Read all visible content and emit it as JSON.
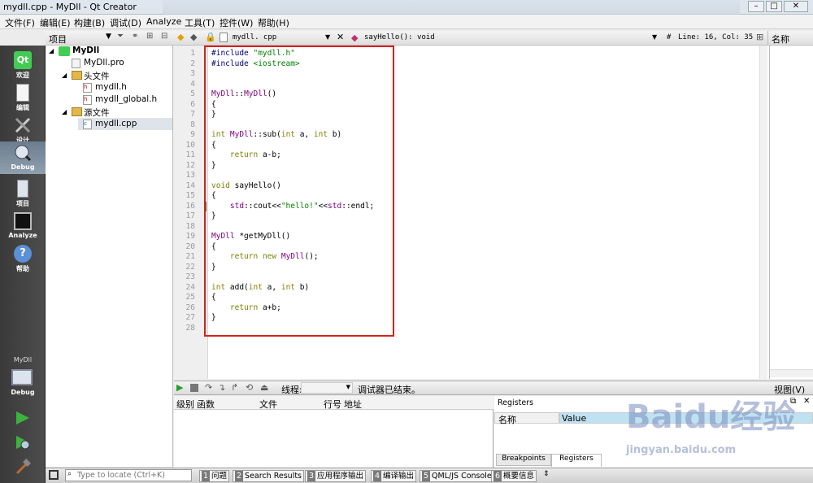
{
  "window": {
    "title": "mydll.cpp - MyDll - Qt Creator"
  },
  "menubar": {
    "items": [
      "文件(F)",
      "编辑(E)",
      "构建(B)",
      "调试(D)",
      "Analyze",
      "工具(T)",
      "控件(W)",
      "帮助(H)"
    ]
  },
  "modes": [
    {
      "label": "欢迎",
      "icon": "qt-logo-icon"
    },
    {
      "label": "编辑",
      "icon": "document-icon"
    },
    {
      "label": "设计",
      "icon": "design-tools-icon"
    },
    {
      "label": "Debug",
      "icon": "debug-bug-icon",
      "active": true
    },
    {
      "label": "项目",
      "icon": "project-icon"
    },
    {
      "label": "Analyze",
      "icon": "analyze-monitor-icon"
    },
    {
      "label": "帮助",
      "icon": "help-icon"
    }
  ],
  "kit": {
    "project": "MyDll",
    "build": "Debug"
  },
  "project_pane": {
    "title": "项目"
  },
  "tree": {
    "root": "MyDll",
    "pro": "MyDll.pro",
    "headers": "头文件",
    "h1": "mydll.h",
    "h2": "mydll_global.h",
    "sources": "源文件",
    "cpp": "mydll.cpp"
  },
  "editor": {
    "file": "mydll. cpp",
    "symbol": "sayHello(): void",
    "position": "Line: 16, Col: 35",
    "hash": "#"
  },
  "right_pane": {
    "title": "名称"
  },
  "code_lines": [
    "#include \"mydll.h\"",
    "#include <iostream>",
    "",
    "",
    "MyDll::MyDll()",
    "{",
    "}",
    "",
    "int MyDll::sub(int a, int b)",
    "{",
    "    return a-b;",
    "}",
    "",
    "void sayHello()",
    "{",
    "    std::cout<<\"hello!\"<<std::endl;",
    "}",
    "",
    "MyDll *getMyDll()",
    "{",
    "    return new MyDll();",
    "}",
    "",
    "int add(int a, int b)",
    "{",
    "    return a+b;",
    "}",
    ""
  ],
  "debugger": {
    "thread_label": "线程:",
    "status": "调试器已结束。",
    "view": "视图(V)"
  },
  "stack_headers": [
    "级别",
    "函数",
    "文件",
    "行号",
    "地址"
  ],
  "registers": {
    "title": "Registers",
    "col_name": "名称",
    "col_value": "Value",
    "tab1": "Breakpoints",
    "tab2": "Registers"
  },
  "statusbar": {
    "locate_placeholder": "Type to locate (Ctrl+K)",
    "panes": [
      {
        "n": "1",
        "label": "问题"
      },
      {
        "n": "2",
        "label": "Search Results"
      },
      {
        "n": "3",
        "label": "应用程序输出"
      },
      {
        "n": "4",
        "label": "编译输出"
      },
      {
        "n": "5",
        "label": "QML/JS Console"
      },
      {
        "n": "6",
        "label": "概要信息"
      }
    ]
  },
  "watermark": {
    "text": "Baidu经验",
    "url": "jingyan.baidu.com"
  }
}
